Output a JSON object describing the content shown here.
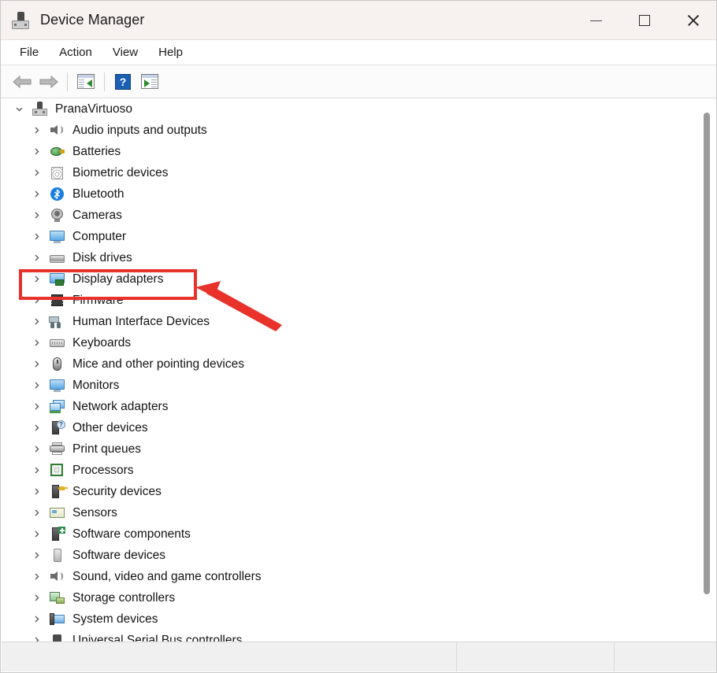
{
  "window": {
    "title": "Device Manager",
    "app_icon": "device-manager-icon",
    "controls": {
      "minimize": "Minimize",
      "maximize": "Maximize",
      "close": "Close"
    }
  },
  "menubar": {
    "items": [
      {
        "label": "File"
      },
      {
        "label": "Action"
      },
      {
        "label": "View"
      },
      {
        "label": "Help"
      }
    ]
  },
  "toolbar": {
    "buttons": [
      {
        "name": "back-button",
        "icon": "back-arrow-icon",
        "label": "Back"
      },
      {
        "name": "forward-button",
        "icon": "forward-arrow-icon",
        "label": "Forward"
      },
      {
        "name": "properties-button",
        "icon": "properties-icon",
        "label": "Properties"
      },
      {
        "name": "help-button",
        "icon": "help-icon",
        "label": "Help"
      },
      {
        "name": "show-hidden-devices-button",
        "icon": "show-hidden-icon",
        "label": "Show hidden devices"
      }
    ],
    "help_glyph": "?"
  },
  "tree": {
    "root": {
      "label": "PranaVirtuoso",
      "icon": "computer-root-icon",
      "expanded": true,
      "chevron": "chevron-down-icon"
    },
    "items": [
      {
        "label": "Audio inputs and outputs",
        "icon": "audio-icon",
        "chevron": "chevron-right-icon"
      },
      {
        "label": "Batteries",
        "icon": "battery-icon",
        "chevron": "chevron-right-icon"
      },
      {
        "label": "Biometric devices",
        "icon": "fingerprint-icon",
        "chevron": "chevron-right-icon"
      },
      {
        "label": "Bluetooth",
        "icon": "bluetooth-icon",
        "chevron": "chevron-right-icon"
      },
      {
        "label": "Cameras",
        "icon": "camera-icon",
        "chevron": "chevron-right-icon"
      },
      {
        "label": "Computer",
        "icon": "monitor-icon",
        "chevron": "chevron-right-icon"
      },
      {
        "label": "Disk drives",
        "icon": "disk-drive-icon",
        "chevron": "chevron-right-icon"
      },
      {
        "label": "Display adapters",
        "icon": "display-adapter-icon",
        "chevron": "chevron-right-icon",
        "highlighted": true
      },
      {
        "label": "Firmware",
        "icon": "firmware-chip-icon",
        "chevron": "chevron-right-icon"
      },
      {
        "label": "Human Interface Devices",
        "icon": "hid-icon",
        "chevron": "chevron-right-icon"
      },
      {
        "label": "Keyboards",
        "icon": "keyboard-icon",
        "chevron": "chevron-right-icon"
      },
      {
        "label": "Mice and other pointing devices",
        "icon": "mouse-icon",
        "chevron": "chevron-right-icon"
      },
      {
        "label": "Monitors",
        "icon": "monitor-icon",
        "chevron": "chevron-right-icon"
      },
      {
        "label": "Network adapters",
        "icon": "network-adapter-icon",
        "chevron": "chevron-right-icon"
      },
      {
        "label": "Other devices",
        "icon": "other-devices-icon",
        "chevron": "chevron-right-icon"
      },
      {
        "label": "Print queues",
        "icon": "printer-icon",
        "chevron": "chevron-right-icon"
      },
      {
        "label": "Processors",
        "icon": "processor-icon",
        "chevron": "chevron-right-icon"
      },
      {
        "label": "Security devices",
        "icon": "security-device-icon",
        "chevron": "chevron-right-icon"
      },
      {
        "label": "Sensors",
        "icon": "sensor-icon",
        "chevron": "chevron-right-icon"
      },
      {
        "label": "Software components",
        "icon": "software-component-icon",
        "chevron": "chevron-right-icon"
      },
      {
        "label": "Software devices",
        "icon": "software-device-icon",
        "chevron": "chevron-right-icon"
      },
      {
        "label": "Sound, video and game controllers",
        "icon": "sound-video-icon",
        "chevron": "chevron-right-icon"
      },
      {
        "label": "Storage controllers",
        "icon": "storage-controller-icon",
        "chevron": "chevron-right-icon"
      },
      {
        "label": "System devices",
        "icon": "system-device-icon",
        "chevron": "chevron-right-icon"
      },
      {
        "label": "Universal Serial Bus controllers",
        "icon": "usb-controller-icon",
        "chevron": "chevron-right-icon"
      }
    ]
  },
  "annotations": {
    "highlight_color": "#e8322a",
    "highlight_target": "Display adapters",
    "arrow": "red-arrow-pointer"
  },
  "statusbar": {
    "text": "",
    "segment_2": "",
    "segment_3": ""
  }
}
